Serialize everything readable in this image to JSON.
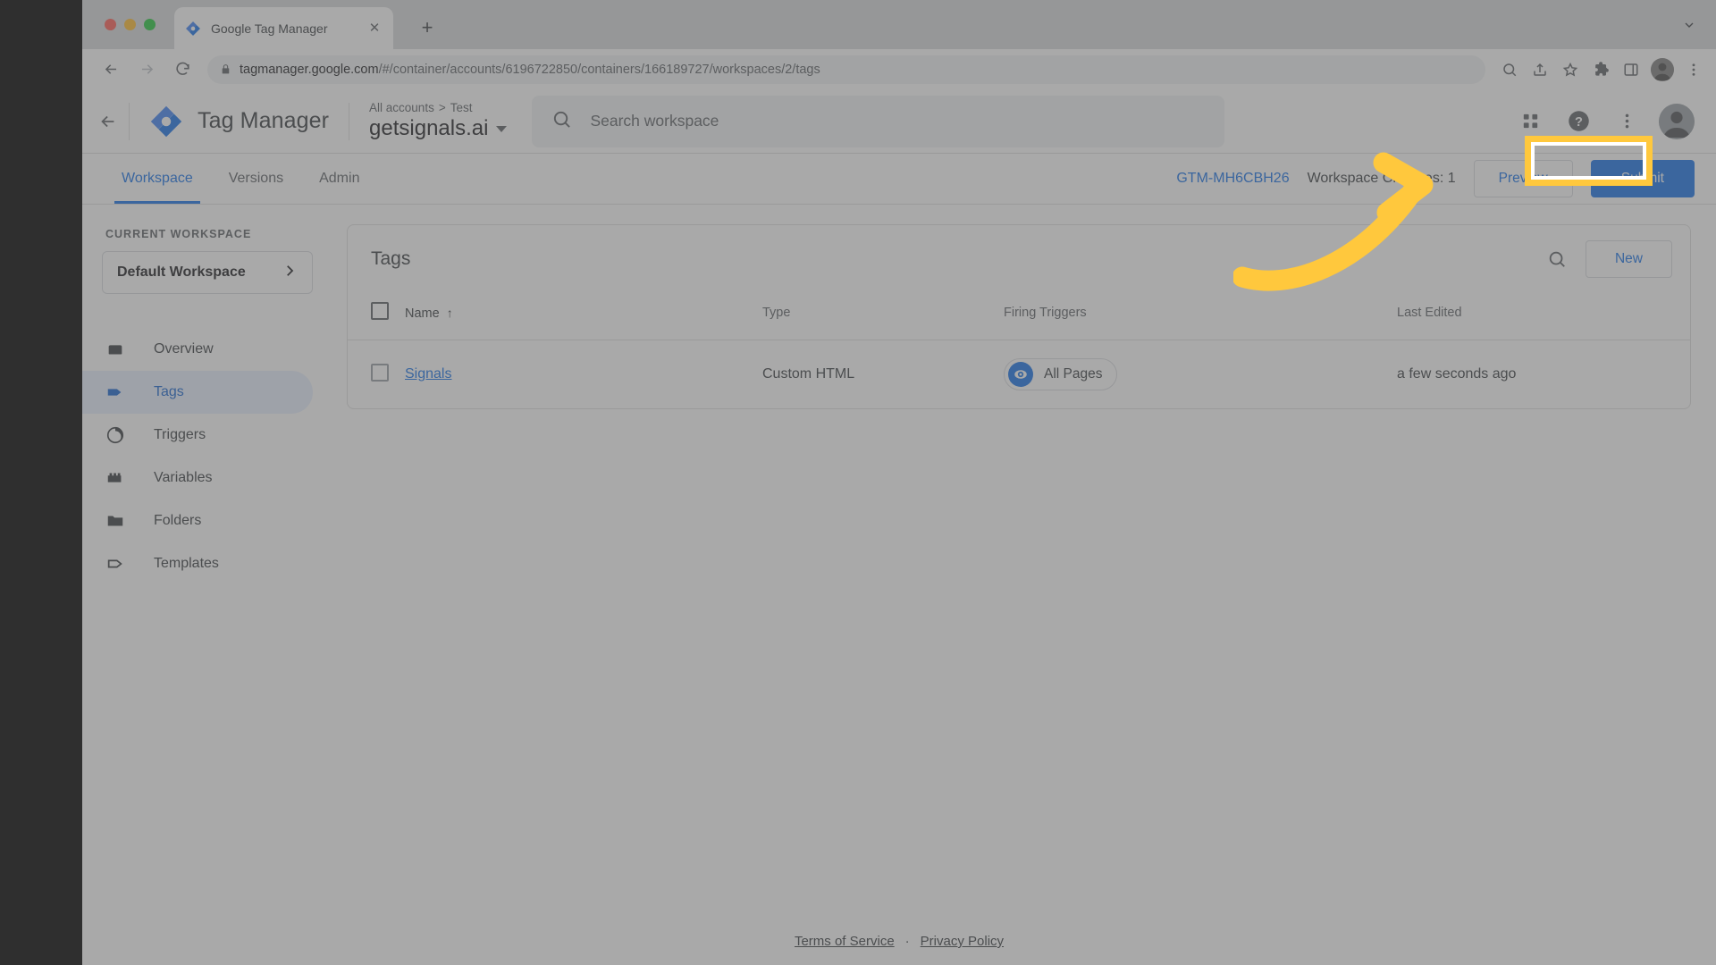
{
  "browser": {
    "tab": {
      "title": "Google Tag Manager",
      "favicon": "tag-manager-favicon",
      "close": "✕"
    },
    "new_tab_label": "+",
    "url_host": "tagmanager.google.com",
    "url_path": "/#/container/accounts/6196722850/containers/166189727/workspaces/2/tags",
    "icons": {
      "back": "back-arrow-icon",
      "forward": "forward-arrow-icon",
      "reload": "reload-icon",
      "lock": "lock-icon",
      "search": "search-icon",
      "share": "share-icon",
      "bookmark": "star-icon",
      "extensions": "puzzle-icon",
      "sidepanel": "side-panel-icon",
      "profile": "profile-avatar",
      "menu": "three-dot-menu-icon"
    }
  },
  "app": {
    "brand": "Tag Manager",
    "breadcrumb": {
      "root": "All accounts",
      "separator": ">",
      "child": "Test"
    },
    "account_name": "getsignals.ai",
    "search": {
      "placeholder": "Search workspace",
      "value": ""
    },
    "header_icons": {
      "apps": "apps-grid-icon",
      "help": "help-circle-icon",
      "more": "three-dot-menu-icon",
      "avatar": "user-avatar"
    },
    "tabs": [
      {
        "label": "Workspace",
        "active": true
      },
      {
        "label": "Versions",
        "active": false
      },
      {
        "label": "Admin",
        "active": false
      }
    ],
    "container_id": "GTM-MH6CBH26",
    "workspace_changes": "Workspace Changes: 1",
    "preview_label": "Preview",
    "submit_label": "Submit"
  },
  "sidebar": {
    "section_label": "CURRENT WORKSPACE",
    "workspace": {
      "name": "Default Workspace",
      "chevron": "chevron-right-icon"
    },
    "items": [
      {
        "label": "Overview",
        "icon": "overview-icon",
        "active": false
      },
      {
        "label": "Tags",
        "icon": "tag-icon",
        "active": true
      },
      {
        "label": "Triggers",
        "icon": "trigger-icon",
        "active": false
      },
      {
        "label": "Variables",
        "icon": "variables-icon",
        "active": false
      },
      {
        "label": "Folders",
        "icon": "folder-icon",
        "active": false
      },
      {
        "label": "Templates",
        "icon": "template-icon",
        "active": false
      }
    ]
  },
  "main": {
    "card_title": "Tags",
    "search_icon": "search-icon",
    "new_label": "New",
    "columns": {
      "name": "Name",
      "sort_indicator": "↑",
      "type": "Type",
      "firing_triggers": "Firing Triggers",
      "last_edited": "Last Edited"
    },
    "rows": [
      {
        "name": "Signals",
        "type": "Custom HTML",
        "trigger": "All Pages",
        "trigger_icon": "all-pages-trigger-icon",
        "last_edited": "a few seconds ago"
      }
    ]
  },
  "footer": {
    "terms": "Terms of Service",
    "separator": "·",
    "privacy": "Privacy Policy"
  },
  "annotation": {
    "highlight_target": "Submit",
    "arrow_color": "#ffc83d",
    "highlight_color": "#ffc83d"
  },
  "colors": {
    "accent_blue": "#1a73e8",
    "highlight_yellow": "#ffc83d",
    "text_primary": "#202124",
    "text_secondary": "#5f6368"
  }
}
